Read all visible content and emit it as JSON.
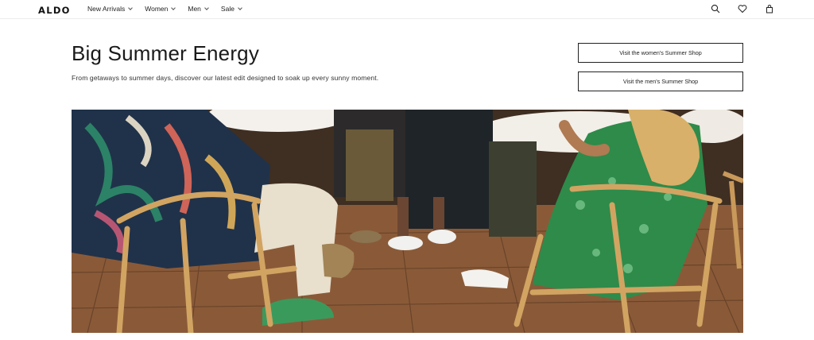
{
  "header": {
    "logo": "ALDO",
    "nav": [
      {
        "label": "New Arrivals"
      },
      {
        "label": "Women"
      },
      {
        "label": "Men"
      },
      {
        "label": "Sale"
      }
    ],
    "icons": [
      "search-icon",
      "heart-icon",
      "bag-icon"
    ]
  },
  "hero": {
    "title": "Big Summer Energy",
    "subtitle": "From getaways to summer days, discover our latest edit designed to soak up every sunny moment.",
    "cta_women": "Visit the women's Summer Shop",
    "cta_men": "Visit the men's Summer Shop"
  },
  "colors": {
    "text": "#1a1a1a",
    "border": "#222222",
    "tile": "#8a5a38",
    "dress_green": "#2e8b4a",
    "shoe_green": "#3a9a5c"
  }
}
